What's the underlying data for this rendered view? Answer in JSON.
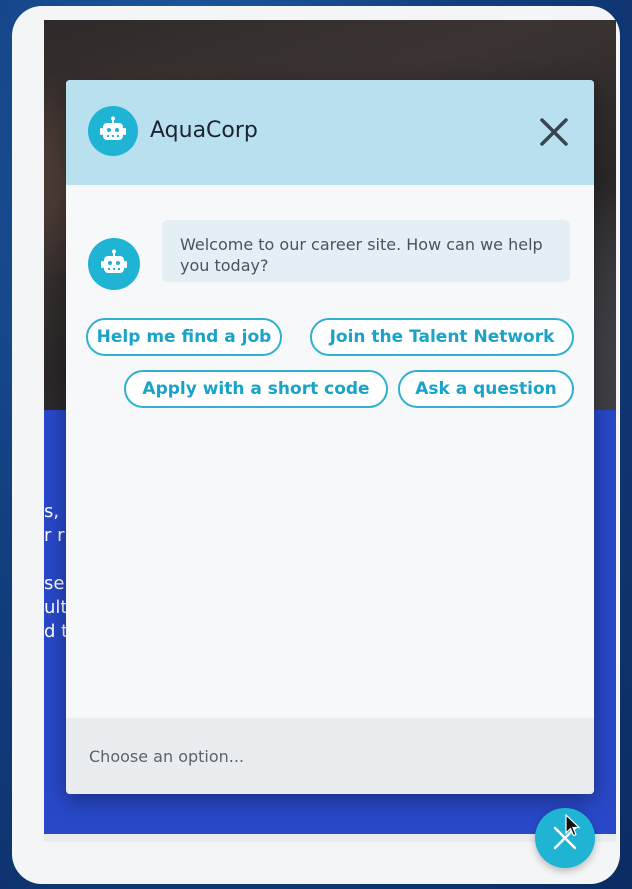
{
  "chat": {
    "brand_name": "AquaCorp",
    "welcome_message": "Welcome to our career site. How can we help you today?",
    "options": [
      {
        "label": "Help me find a job"
      },
      {
        "label": "Join the Talent Network"
      },
      {
        "label": "Apply with a short code"
      },
      {
        "label": "Ask a question"
      }
    ],
    "input_placeholder": "Choose an option..."
  },
  "background_page": {
    "text_fragments": [
      "s, c",
      "r r",
      "",
      "se",
      "ult",
      "d t"
    ]
  },
  "colors": {
    "accent": "#1fb3d4",
    "header": "#b9e0ef",
    "page_band": "#2848c8"
  },
  "icons": {
    "avatar": "robot-icon",
    "close": "close-icon",
    "launcher": "close-icon"
  }
}
